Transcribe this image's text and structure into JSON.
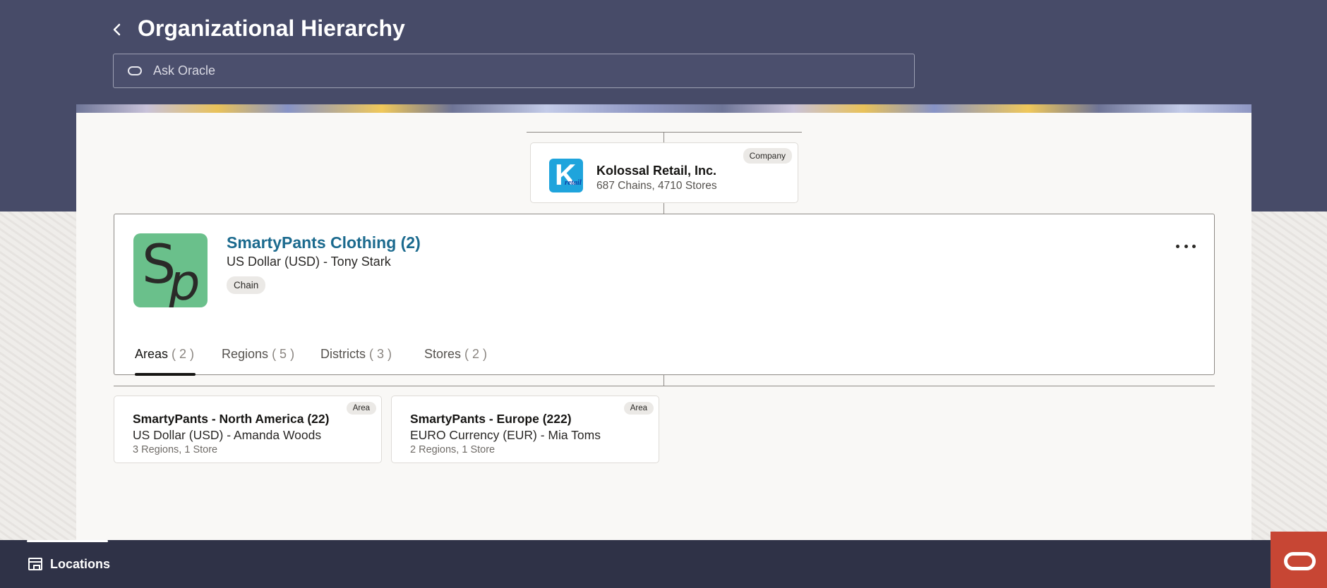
{
  "header": {
    "back_icon": "chevron-left-icon",
    "title": "Organizational Hierarchy",
    "search_placeholder": "Ask Oracle",
    "search_icon": "oracle-pill-icon"
  },
  "company": {
    "name": "Kolossal Retail, Inc.",
    "meta": "687 Chains, 4710 Stores",
    "badge": "Company",
    "logo_letter": "K",
    "logo_sub": "retail"
  },
  "chain": {
    "name": "SmartyPants Clothing (2)",
    "subtitle": "US Dollar (USD) - Tony Stark",
    "badge": "Chain",
    "more_icon": "ellipsis-icon",
    "tabs": [
      {
        "label": "Areas",
        "count": "( 2 )",
        "active": true
      },
      {
        "label": "Regions",
        "count": "( 5 )",
        "active": false
      },
      {
        "label": "Districts",
        "count": "( 3 )",
        "active": false
      },
      {
        "label": "Stores",
        "count": "( 2 )",
        "active": false
      }
    ]
  },
  "areas": [
    {
      "name": "SmartyPants - North America (22)",
      "subtitle": "US Dollar (USD) - Amanda Woods",
      "meta": "3 Regions, 1 Store",
      "badge": "Area"
    },
    {
      "name": "SmartyPants - Europe (222)",
      "subtitle": "EURO Currency (EUR) - Mia Toms",
      "meta": "2 Regions, 1 Store",
      "badge": "Area"
    }
  ],
  "footer": {
    "nav_icon": "store-icon",
    "nav_label": "Locations",
    "assistant_icon": "oracle-logo-icon"
  },
  "colors": {
    "header_band": "#474b68",
    "footer": "#2f3247",
    "link": "#1b6a8e",
    "oracle_red": "#c74634",
    "chain_logo": "#6ac08b",
    "company_logo": "#1fa4dc"
  }
}
